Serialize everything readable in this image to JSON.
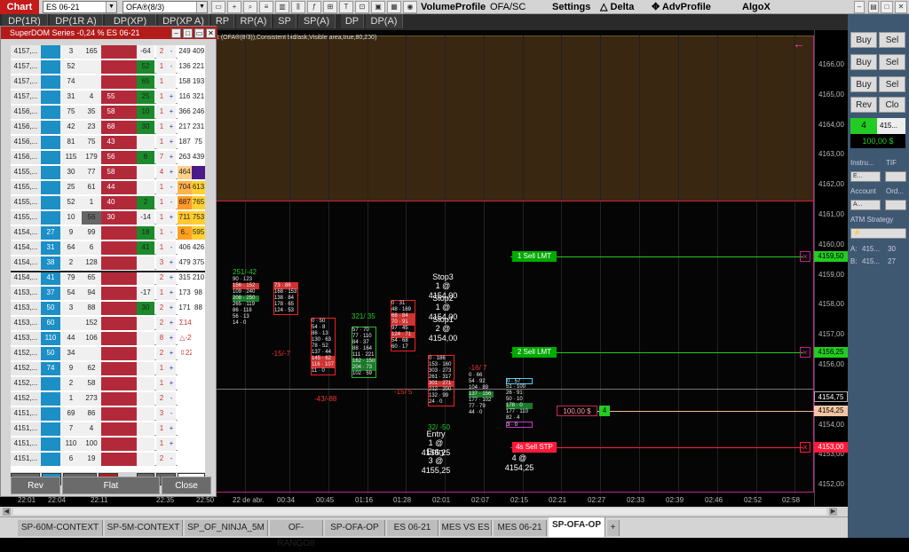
{
  "topbar": {
    "chart_button": "Chart",
    "instrument": "ES 06-21",
    "indicator": "OFA®(8/3)",
    "tabs_top": [
      "DP(1R)",
      "DP(1R A)",
      "DP(XP)",
      "DP(XP A)"
    ],
    "tabs": [
      "RP",
      "RP(A)",
      "SP",
      "SP(A)",
      "DP",
      "DP(A)"
    ],
    "volume_profile": "VolumeProfile",
    "ofa_sc": "OFA/SC",
    "settings": "Settings",
    "delta": "Delta",
    "adv_profile": "AdvProfile",
    "algox": "AlgoX",
    "triangle_icon": "triangle-icon",
    "move_icon": "move-icon"
  },
  "chart": {
    "indicator_label": "1 (OFA®(8/3)),Consistent bid/ask,Visible area,true,80,200)",
    "f_button": "F",
    "price_labels": [
      "4166,00",
      "4165,00",
      "4164,00",
      "4163,00",
      "4162,00",
      "4161,00",
      "4160,00",
      "4159,00",
      "4158,00",
      "4157,00",
      "4156,00",
      "4155,00",
      "4154,00",
      "4153,00",
      "4152,00"
    ],
    "time_labels": [
      "22:01",
      "22:04",
      "22:11",
      "22:35",
      "22:50",
      "22 de abr.",
      "00:34",
      "00:45",
      "01:16",
      "01:28",
      "02:01",
      "02:07",
      "02:15",
      "02:21",
      "02:27",
      "02:33",
      "02:39",
      "02:46",
      "02:52",
      "02:58"
    ],
    "orders": [
      {
        "label": "1  Sell LMT",
        "price": "4159,50",
        "color": "#22cc22"
      },
      {
        "label": "2  Sell LMT",
        "price": "4156,25",
        "color": "#22cc22"
      },
      {
        "label": "4s  Sell STP",
        "price": "4153,00",
        "color": "#ff1a3a"
      }
    ],
    "axis_tags": [
      "4154,75",
      "4154,25"
    ],
    "position_pnl": "100,00 $",
    "position_qty": "4",
    "annotations": [
      "Stop3",
      "1 @ 4154,00",
      "Stop2",
      "1 @ 4154,00",
      "Stop1",
      "2 @ 4154,00",
      "Entry",
      "1 @ 4155,25",
      "Entry",
      "3 @ 4155,25",
      "4 @ 4154,25"
    ],
    "cluster_headers": [
      "251/-42",
      "321/ 35",
      "-16/ 7"
    ],
    "cluster_footers": [
      "-15/-7",
      "-43/-88",
      "-15/ 5",
      "32/ -50"
    ]
  },
  "dom": {
    "title": "SuperDOM Series -0,24 % ES 06-21",
    "rows": [
      {
        "price": "4157,...",
        "buy": "",
        "ask_sz": "3",
        "ask": "165",
        "bid": "",
        "col6": "-64",
        "c7": "2",
        "c8": "-",
        "v1": "249",
        "v2": "409"
      },
      {
        "price": "4157,...",
        "buy": "",
        "ask_sz": "52",
        "ask": "",
        "bid": "",
        "col6": "52",
        "c7": "1",
        "c8": "-",
        "v1": "136",
        "v2": "221"
      },
      {
        "price": "4157,...",
        "buy": "",
        "ask_sz": "74",
        "ask": "",
        "bid": "",
        "col6": "65",
        "c7": "1",
        "c8": "",
        "v1": "158",
        "v2": "193"
      },
      {
        "price": "4157,...",
        "buy": "",
        "ask_sz": "31",
        "ask": "4",
        "bid": "55",
        "col6": "25",
        "c7": "1",
        "c8": "+",
        "v1": "116",
        "v2": "321"
      },
      {
        "price": "4156,...",
        "buy": "",
        "ask_sz": "75",
        "ask": "35",
        "bid": "58",
        "col6": "10",
        "c7": "1",
        "c8": "+",
        "v1": "366",
        "v2": "246"
      },
      {
        "price": "4156,...",
        "buy": "",
        "ask_sz": "42",
        "ask": "23",
        "bid": "68",
        "col6": "30",
        "c7": "1",
        "c8": "+",
        "v1": "217",
        "v2": "231"
      },
      {
        "price": "4156,...",
        "buy": "",
        "ask_sz": "81",
        "ask": "75",
        "bid": "43",
        "col6": "",
        "c7": "1",
        "c8": "+",
        "v1": "187",
        "v2": "75"
      },
      {
        "price": "4156,...",
        "buy": "",
        "ask_sz": "115",
        "ask": "179",
        "bid": "56",
        "col6": "6",
        "c7": "7",
        "c8": "+",
        "v1": "263",
        "v2": "439"
      },
      {
        "price": "4155,...",
        "buy": "",
        "ask_sz": "30",
        "ask": "77",
        "bid": "58",
        "col6": "",
        "c7": "4",
        "c8": "+",
        "v1": "464",
        "v2": ""
      },
      {
        "price": "4155,...",
        "buy": "",
        "ask_sz": "25",
        "ask": "61",
        "bid": "44",
        "col6": "",
        "c7": "1",
        "c8": "-",
        "v1": "704",
        "v2": "613"
      },
      {
        "price": "4155,...",
        "buy": "",
        "ask_sz": "52",
        "ask": "1",
        "bid": "40",
        "col6": "2",
        "c7": "1",
        "c8": "-",
        "v1": "687",
        "v2": "765"
      },
      {
        "price": "4155,...",
        "buy": "",
        "ask_sz": "10",
        "ask": "56",
        "bid": "30",
        "col6": "-14",
        "c7": "1",
        "c8": "+",
        "v1": "711",
        "v2": "753"
      },
      {
        "price": "4154,...",
        "buy": "27",
        "ask_sz": "9",
        "ask": "99",
        "bid": "",
        "col6": "18",
        "c7": "1",
        "c8": "-",
        "v1": "6..",
        "v2": "595"
      },
      {
        "price": "4154,...",
        "buy": "31",
        "ask_sz": "64",
        "ask": "6",
        "bid": "",
        "col6": "41",
        "c7": "1",
        "c8": "-",
        "v1": "406",
        "v2": "426"
      },
      {
        "price": "4154,...",
        "buy": "38",
        "ask_sz": "2",
        "ask": "128",
        "bid": "",
        "col6": "",
        "c7": "3",
        "c8": "+",
        "v1": "479",
        "v2": "375"
      },
      {
        "price": "4154,...",
        "buy": "41",
        "ask_sz": "79",
        "ask": "65",
        "bid": "",
        "col6": "",
        "c7": "2",
        "c8": "+",
        "v1": "315",
        "v2": "210"
      },
      {
        "price": "4153,...",
        "buy": "37",
        "ask_sz": "54",
        "ask": "94",
        "bid": "",
        "col6": "-17",
        "c7": "1",
        "c8": "+",
        "v1": "173",
        "v2": "98"
      },
      {
        "price": "4153,...",
        "buy": "50",
        "ask_sz": "3",
        "ask": "88",
        "bid": "",
        "col6": "30",
        "c7": "2",
        "c8": "+",
        "v1": "171",
        "v2": "88"
      },
      {
        "price": "4153,...",
        "buy": "60",
        "ask_sz": "",
        "ask": "152",
        "bid": "",
        "col6": "",
        "c7": "2",
        "c8": "+",
        "v1": "Σ14589",
        "v2": ""
      },
      {
        "price": "4153,...",
        "buy": "110",
        "ask_sz": "44",
        "ask": "106",
        "bid": "",
        "col6": "",
        "c7": "8",
        "c8": "+",
        "v1": "△-207..",
        "v2": ""
      },
      {
        "price": "4152,...",
        "buy": "50",
        "ask_sz": "34",
        "ask": "",
        "bid": "",
        "col6": "",
        "c7": "2",
        "c8": "+",
        "v1": "⇳22 |...",
        "v2": ""
      },
      {
        "price": "4152,...",
        "buy": "74",
        "ask_sz": "9",
        "ask": "62",
        "bid": "",
        "col6": "",
        "c7": "1",
        "c8": "+",
        "v1": "",
        "v2": ""
      },
      {
        "price": "4152,...",
        "buy": "",
        "ask_sz": "2",
        "ask": "58",
        "bid": "",
        "col6": "",
        "c7": "1",
        "c8": "+",
        "v1": "",
        "v2": ""
      },
      {
        "price": "4152,...",
        "buy": "",
        "ask_sz": "1",
        "ask": "273",
        "bid": "",
        "col6": "",
        "c7": "2",
        "c8": "-",
        "v1": "",
        "v2": ""
      },
      {
        "price": "4151,...",
        "buy": "",
        "ask_sz": "69",
        "ask": "86",
        "bid": "",
        "col6": "",
        "c7": "3",
        "c8": "-",
        "v1": "",
        "v2": ""
      },
      {
        "price": "4151,...",
        "buy": "",
        "ask_sz": "7",
        "ask": "4",
        "bid": "",
        "col6": "",
        "c7": "1",
        "c8": "+",
        "v1": "",
        "v2": ""
      },
      {
        "price": "4151,...",
        "buy": "",
        "ask_sz": "110",
        "ask": "100",
        "bid": "",
        "col6": "",
        "c7": "1",
        "c8": "+",
        "v1": "",
        "v2": ""
      },
      {
        "price": "4151,...",
        "buy": "",
        "ask_sz": "6",
        "ask": "19",
        "bid": "",
        "col6": "",
        "c7": "2",
        "c8": "-",
        "v1": "",
        "v2": ""
      }
    ],
    "rev_button": "Rev",
    "flat_button": "Flat",
    "close_button": "Close"
  },
  "rpanel": {
    "buy": "Buy",
    "sell": "Sel",
    "rev": "Rev",
    "close": "Clo",
    "qty": "4",
    "price": "415...",
    "pnl": "100,00 $",
    "instrument_lbl": "Instru...",
    "tif_lbl": "TIF",
    "instrument_val": "E...",
    "account_lbl": "Account",
    "order_lbl": "Ord...",
    "account_val": "A...",
    "atm_lbl": "ATM Strategy",
    "ask_lbl": "A:",
    "ask_price": "415...",
    "ask_size": "30",
    "bid_lbl": "B:",
    "bid_price": "415...",
    "bid_size": "27"
  },
  "tabs": [
    "SP-60M-CONTEXT",
    "SP-5M-CONTEXT",
    "SP_OF_NINJA_5M",
    "OF-RANGO8",
    "SP-OFA-OP",
    "ES 06-21",
    "MES VS ES",
    "MES 06-21",
    "SP-OFA-OP",
    "+"
  ],
  "active_tab": 8,
  "colors": {
    "accent": "#b31a1a",
    "buy": "#22cc22",
    "sell_stop": "#ff1a3a",
    "ask": "#b22a3a",
    "bid": "#1b8fc6",
    "zone": "#3a2711"
  }
}
